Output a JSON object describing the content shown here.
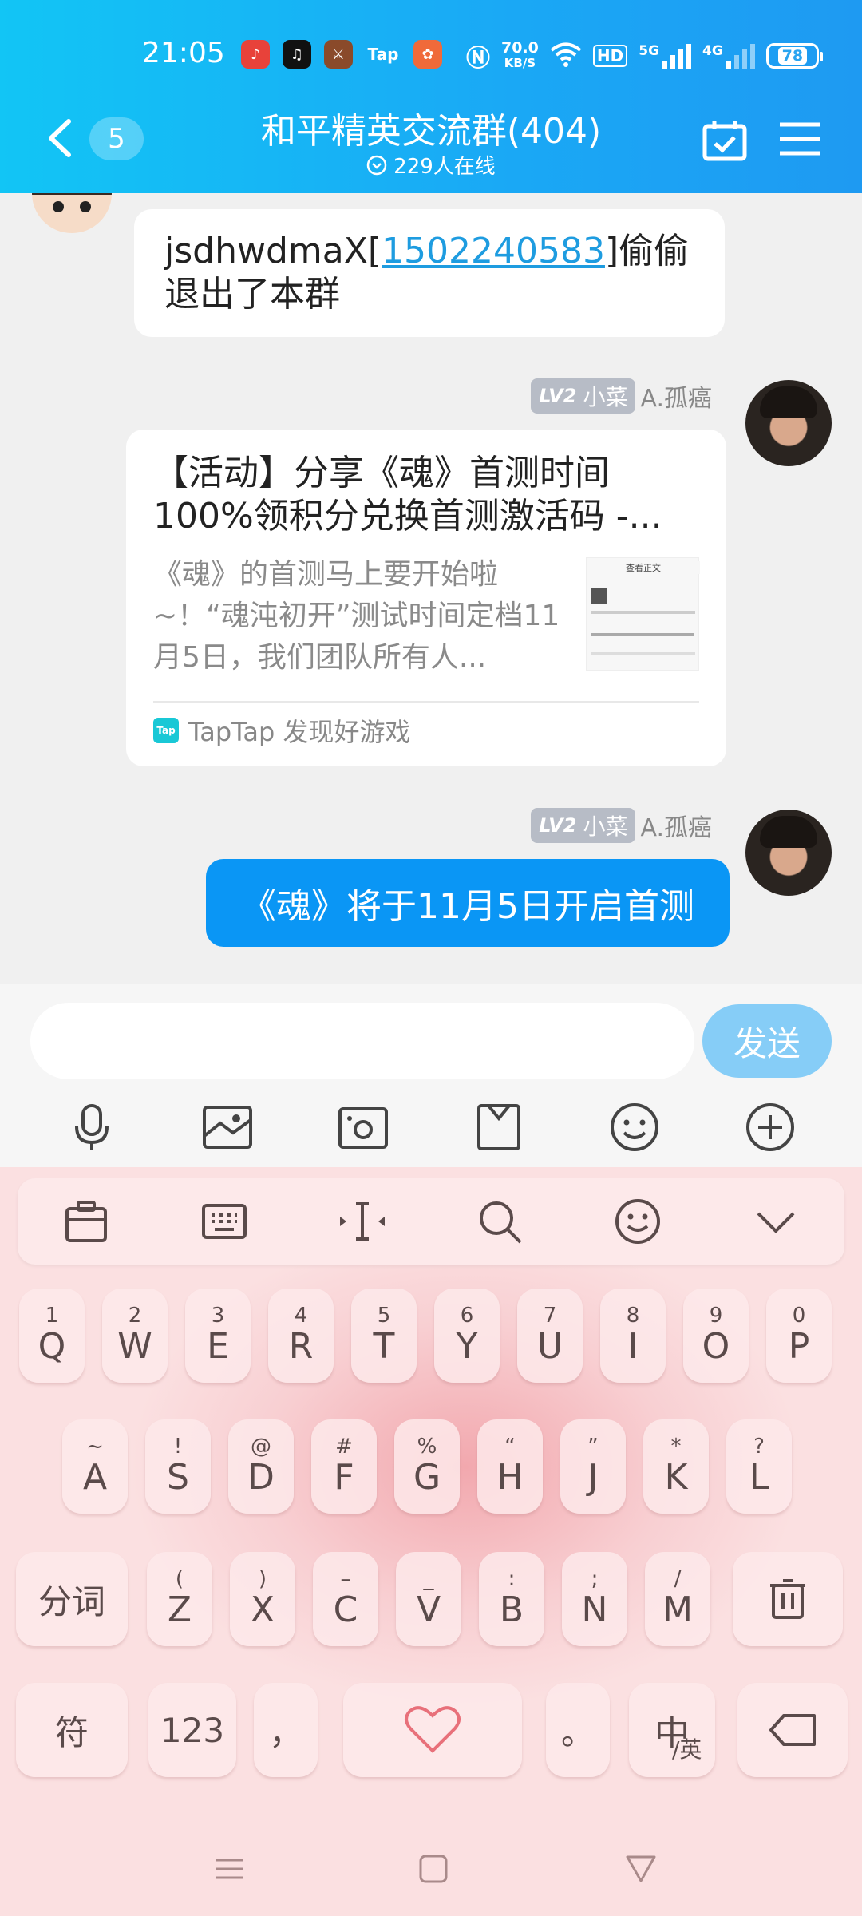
{
  "status_bar": {
    "time": "21:05",
    "net_speed": "70.0",
    "net_unit": "KB/S",
    "hd_label": "HD",
    "sig1_label": "5G",
    "sig2_label": "4G",
    "battery": "78",
    "apps": [
      "music-app-icon",
      "tiktok-icon",
      "game-icon",
      "taptap-icon",
      "app-icon"
    ]
  },
  "header": {
    "back_count": "5",
    "title": "和平精英交流群(404)",
    "online": "229人在线"
  },
  "messages": {
    "system": {
      "prefix": "jsdhwdmaX[",
      "qq": "1502240583",
      "suffix": "]偷偷退出了本群"
    },
    "card": {
      "sender_level": "LV2",
      "sender_title": "小菜",
      "sender_name": "A.孤癌",
      "title": "【活动】分享《魂》首测时间100%领积分兑换首测激活码 -...",
      "desc": "《魂》的首测马上要开始啦~！“魂沌初开”测试时间定档11月5日，我们团队所有人...",
      "thumb_title": "查看正文",
      "source_logo": "Tap",
      "source": "TapTap 发现好游戏"
    },
    "text": {
      "sender_level": "LV2",
      "sender_title": "小菜",
      "sender_name": "A.孤癌",
      "text": "《魂》将于11月5日开启首测"
    }
  },
  "input": {
    "value": "",
    "send_label": "发送",
    "tools": [
      "microphone-icon",
      "image-icon",
      "camera-icon",
      "file-icon",
      "emoji-icon",
      "plus-icon"
    ]
  },
  "keyboard": {
    "toolbar": [
      "clipboard-icon",
      "keyboard-icon",
      "cursor-icon",
      "search-icon",
      "emoji-icon",
      "collapse-icon"
    ],
    "row1": [
      {
        "sub": "1",
        "main": "Q"
      },
      {
        "sub": "2",
        "main": "W"
      },
      {
        "sub": "3",
        "main": "E"
      },
      {
        "sub": "4",
        "main": "R"
      },
      {
        "sub": "5",
        "main": "T"
      },
      {
        "sub": "6",
        "main": "Y"
      },
      {
        "sub": "7",
        "main": "U"
      },
      {
        "sub": "8",
        "main": "I"
      },
      {
        "sub": "9",
        "main": "O"
      },
      {
        "sub": "0",
        "main": "P"
      }
    ],
    "row2": [
      {
        "sub": "~",
        "main": "A"
      },
      {
        "sub": "!",
        "main": "S"
      },
      {
        "sub": "@",
        "main": "D"
      },
      {
        "sub": "#",
        "main": "F"
      },
      {
        "sub": "%",
        "main": "G"
      },
      {
        "sub": "“",
        "main": "H"
      },
      {
        "sub": "”",
        "main": "J"
      },
      {
        "sub": "*",
        "main": "K"
      },
      {
        "sub": "?",
        "main": "L"
      }
    ],
    "row3": [
      {
        "sub": "(",
        "main": "Z"
      },
      {
        "sub": ")",
        "main": "X"
      },
      {
        "sub": "–",
        "main": "C"
      },
      {
        "sub": "_",
        "main": "V"
      },
      {
        "sub": ":",
        "main": "B"
      },
      {
        "sub": ";",
        "main": "N"
      },
      {
        "sub": "/",
        "main": "M"
      }
    ],
    "fenci": "分词",
    "fu": "符",
    "num": "123",
    "comma": "，",
    "period": "。",
    "lang_main": "中",
    "lang_sub": "/英"
  }
}
